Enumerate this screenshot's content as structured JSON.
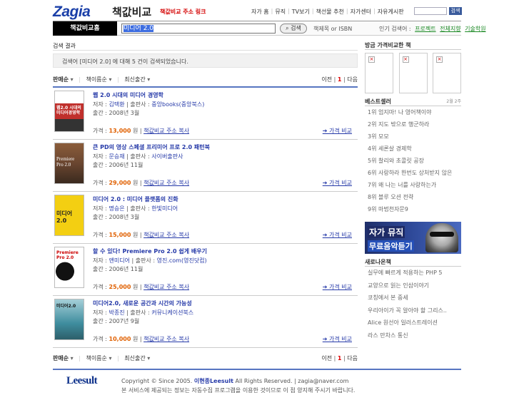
{
  "header": {
    "logo": "Zagia",
    "logo_sub": "책값비교",
    "promo": "책값비교 주소 링크",
    "topnav": [
      "자가 홈",
      "뮤직",
      "TV보기",
      "책선물 추천",
      "자가센터",
      "자유게시판"
    ],
    "search_button": "검색"
  },
  "searchbar": {
    "tab": "책값비교홈",
    "query": "미디어 2.0",
    "button": "검색",
    "hint": "책제목 or ISBN",
    "popular_label": "인기 검색어 :",
    "popular": [
      "프로젝트",
      "전체지향",
      "기술학원"
    ]
  },
  "main": {
    "section_title": "검색 결과",
    "result_text": "검색어 [미디어 2.0] 에 대해 5 건이 검색되었습니다.",
    "sort": [
      "판매순",
      "책이름순",
      "최신출간"
    ],
    "pager": {
      "prev": "이전",
      "current": "1",
      "next": "다음"
    },
    "items": [
      {
        "title": "웹 2.0 시대의 미디어 경영학",
        "author": "김택환",
        "publisher": "중앙books(중앙북스)",
        "date": "출간 : 2008년 3월",
        "price": "13,000",
        "link": "책값비교 주소 복사",
        "compare": "가격 비교",
        "cover": "웹2.0 시대의 미디어경영학",
        "cover_color": "#c0302c"
      },
      {
        "title": "큰 PD의 영상 스페셜 프리미어 프로 2.0 패턴북",
        "author": "문승재",
        "publisher": "사이버출판사",
        "date": "출간 : 2006년 11월",
        "price": "29,000",
        "link": "책값비교 주소 복사",
        "compare": "가격 비교",
        "cover": "Premiere Pro 2.0",
        "cover_color": "#6a4630"
      },
      {
        "title": "미디어 2.0 : 미디어 플랫폼의 진화",
        "author": "명승은",
        "publisher": "한빛미디어",
        "date": "출간 : 2008년 3월",
        "price": "15,000",
        "link": "책값비교 주소 복사",
        "compare": "가격 비교",
        "cover": "미디어 2.0",
        "cover_color": "#f3cf12"
      },
      {
        "title": "할 수 있다! Premiere Pro 2.0 쉽게 배우기",
        "author": "앤미디어",
        "publisher": "영진.com(영진닷컴)",
        "date": "출간 : 2006년 11월",
        "price": "25,000",
        "link": "책값비교 주소 복사",
        "compare": "가격 비교",
        "cover": "Premiere Pro 2.0",
        "cover_color": "#ffffff"
      },
      {
        "title": "미디어2.0, 새로운 공간과 시간의 가능성",
        "author": "박종진",
        "publisher": "커뮤니케이션북스",
        "date": "출간 : 2007년 9월",
        "price": "10,000",
        "link": "책값비교 주소 복사",
        "compare": "가격 비교",
        "cover": "미디어2.0",
        "cover_color": "#3f8d9e"
      }
    ],
    "labels": {
      "author": "저자 :",
      "publisher": "출판사 :",
      "price": "가격 :",
      "won": "원"
    }
  },
  "right": {
    "recent_title": "방금 가격비교한 책",
    "bestseller_title": "베스트셀러",
    "bestseller_date": "2월 2주",
    "bestsellers": [
      "1위 엄지마! 나 영어책이야",
      "2위 지도 밖으로 행군하라",
      "3위 모모",
      "4위 세론살 경제학",
      "5위 찰리와 초콜릿 공장",
      "6위 사랑하라 한번도 상처받지 않은",
      "7위 왜 나는 너를 사랑하는가",
      "8위 블루 오션 전략",
      "9위 마법천자문9"
    ],
    "banner_line1": "자가 뮤직",
    "banner_line2": "무료음악듣기",
    "new_title": "새로나온책",
    "new_books": [
      "실무에 빠르게 적용하는 PHP 5",
      "교양으로 읽는 인삼이야기",
      "코칭에서 본 중세",
      "우리아이가 꼭 알아야 할 그리스..",
      "Alice 원선아 일러스트레이션",
      "라스 만차스 통신"
    ]
  },
  "footer": {
    "logo": "Leesult",
    "copyright_pre": "Copyright © Since 2005. ",
    "copyright_name": "이현종Leesult",
    "copyright_post": " All Rights Reserved. | zagia@naver.com",
    "notice": "본 서비스에 제공되는 정보는 자동수집 프로그램을 이용한 것이므로 이 점 양지해 주시기 바랍니다."
  }
}
